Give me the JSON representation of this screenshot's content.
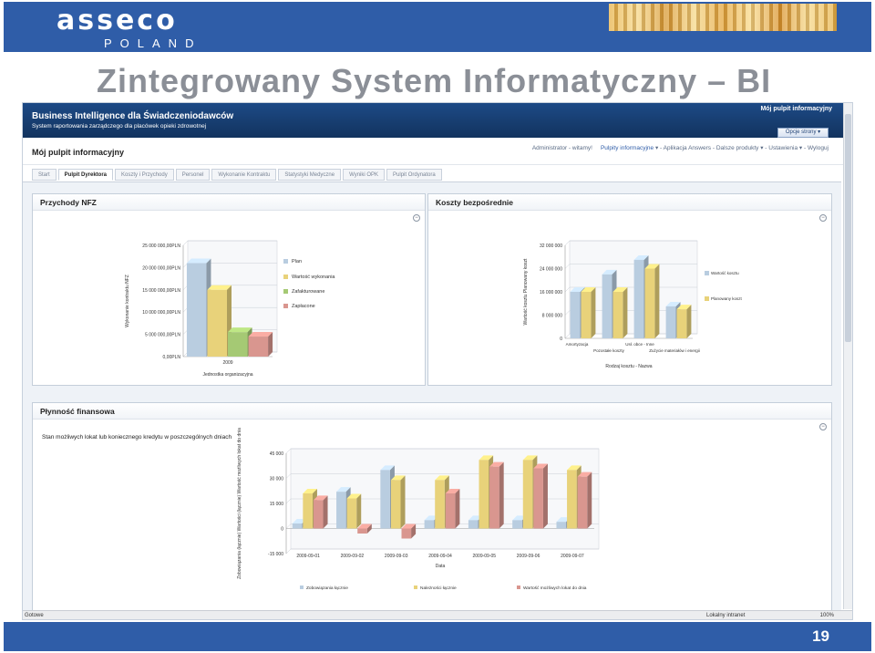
{
  "slide": {
    "logo_text": "asseco",
    "logo_country": "POLAND",
    "title": "Zintegrowany System Informatyczny – BI",
    "page_number": "19"
  },
  "app": {
    "title": "Business Intelligence dla Świadczeniodawców",
    "subtitle": "System raportowania zarządczego dla placówek opieki zdrowotnej",
    "header_right": "Mój pulpit informacyjny",
    "dashboard_title": "Mój pulpit informacyjny",
    "user": "Administrator - witamy!",
    "nav": [
      "Pulpity informacyjne",
      "Aplikacja Answers",
      "Dalsze produkty",
      "Ustawienia",
      "Wyloguj"
    ],
    "options_button": "Opcje strony",
    "tabs": [
      "Start",
      "Pulpit Dyrektora",
      "Koszty i Przychody",
      "Personel",
      "Wykonanie Kontraktu",
      "Statystyki Medyczne",
      "Wyniki OPK",
      "Pulpit Ordynatora"
    ],
    "active_tab": 1,
    "status_left": "Gotowe",
    "status_zone": "Lokalny intranet",
    "status_zoom": "100%"
  },
  "panels": {
    "p1_title": "Przychody NFZ",
    "p2_title": "Koszty bezpośrednie",
    "p3_title": "Płynność finansowa",
    "p3_subtitle": "Stan możliwych lokat lub koniecznego kredytu w poszczególnych dniach"
  },
  "colors": {
    "series_blue": "#b9cde0",
    "series_gold": "#e8d27a",
    "series_green": "#a5c974",
    "series_pink": "#d9968f"
  },
  "chart_data": [
    {
      "type": "bar",
      "title": "",
      "xlabel": "Jednostka organizacyjna",
      "ylabel": "Wykonanie kontraktu NFZ",
      "categories": [
        "2009"
      ],
      "ylim": [
        0,
        25000000
      ],
      "yticks": [
        "0,00PLN",
        "5 000 000,00PLN",
        "10 000 000,00PLN",
        "15 000 000,00PLN",
        "20 000 000,00PLN",
        "25 000 000,00PLN"
      ],
      "series": [
        {
          "name": "Plan",
          "values": [
            21000000
          ]
        },
        {
          "name": "Wartość wykonania",
          "values": [
            15000000
          ]
        },
        {
          "name": "Zafakturowane",
          "values": [
            5500000
          ]
        },
        {
          "name": "Zapłacone",
          "values": [
            4500000
          ]
        }
      ],
      "legend": "right"
    },
    {
      "type": "bar",
      "title": "",
      "xlabel": "Rodzaj kosztu - Nazwa",
      "ylabel": "Wartość kosztu Planowany koszt",
      "categories": [
        "Amortyzacja",
        "Pozostałe koszty",
        "Usługi obce - Inne",
        "Zużycie materiałów i energii",
        ""
      ],
      "category_label_lines": [
        "Amortyzacja",
        "Usł. obce - Inne",
        "Pozostałe koszty",
        "Zużycie materiałów i energii"
      ],
      "ylim": [
        0,
        32000000
      ],
      "yticks": [
        "0",
        "8 000 000",
        "16 000 000",
        "24 000 000",
        "32 000 000"
      ],
      "series": [
        {
          "name": "Wartość kosztu",
          "values": [
            16000000,
            22000000,
            27000000,
            11000000
          ]
        },
        {
          "name": "Planowany koszt",
          "values": [
            16000000,
            16000000,
            24000000,
            10000000
          ]
        }
      ],
      "legend": "right"
    },
    {
      "type": "bar",
      "title": "",
      "xlabel": "Data",
      "ylabel": "Zobowiązania (łącznie) Wartości (łącznie) Wartość możliwych lokat do dnia",
      "categories": [
        "2009-09-01",
        "2009-09-02",
        "2009-09-03",
        "2009-09-04",
        "2009-09-05",
        "2009-09-06",
        "2009-09-07"
      ],
      "ylim": [
        -15000,
        45000
      ],
      "yticks": [
        "-15 000",
        "0",
        "15 000",
        "30 000",
        "45 000"
      ],
      "series": [
        {
          "name": "Zobowiązania łącznie",
          "values": [
            3000,
            22000,
            35000,
            5000,
            5000,
            5000,
            4000
          ]
        },
        {
          "name": "Należności łącznie",
          "values": [
            21000,
            18000,
            29000,
            29000,
            41000,
            41000,
            35000
          ]
        },
        {
          "name": "Wartość możliwych lokat do dnia",
          "values": [
            17000,
            -3000,
            -6000,
            21000,
            37000,
            36000,
            31000
          ]
        }
      ],
      "legend": "bottom"
    }
  ]
}
